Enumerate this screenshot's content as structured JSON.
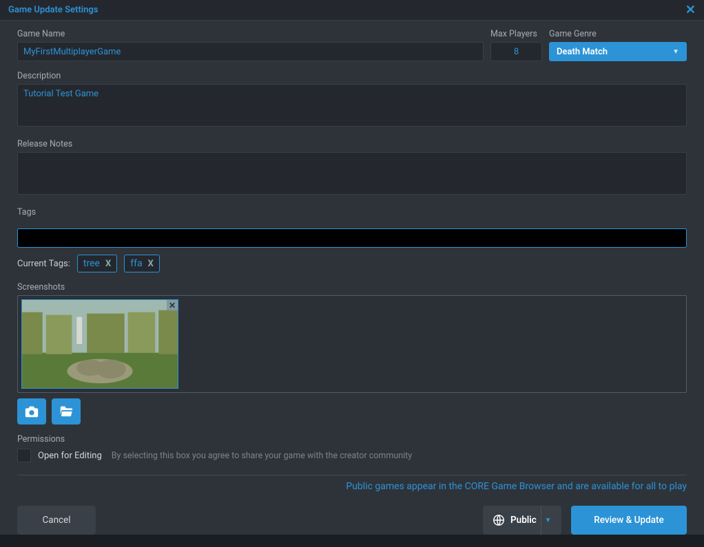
{
  "titlebar": {
    "title": "Game Update Settings"
  },
  "form": {
    "game_name_label": "Game Name",
    "game_name_value": "MyFirstMultiplayerGame",
    "max_players_label": "Max Players",
    "max_players_value": "8",
    "genre_label": "Game Genre",
    "genre_value": "Death Match",
    "description_label": "Description",
    "description_value": "Tutorial Test Game",
    "release_notes_label": "Release Notes",
    "release_notes_value": "",
    "tags_label": "Tags",
    "tags_input_value": "",
    "current_tags_label": "Current Tags:",
    "tags": [
      {
        "label": "tree"
      },
      {
        "label": "ffa"
      }
    ],
    "screenshots_label": "Screenshots",
    "permissions_label": "Permissions",
    "open_for_editing_label": "Open for Editing",
    "open_for_editing_desc": "By selecting this box you agree to share your game with the creator community",
    "public_note": "Public games appear in the CORE Game Browser and are available for all to play"
  },
  "footer": {
    "cancel": "Cancel",
    "visibility": "Public",
    "review": "Review & Update"
  },
  "tag_remove_glyph": "X"
}
